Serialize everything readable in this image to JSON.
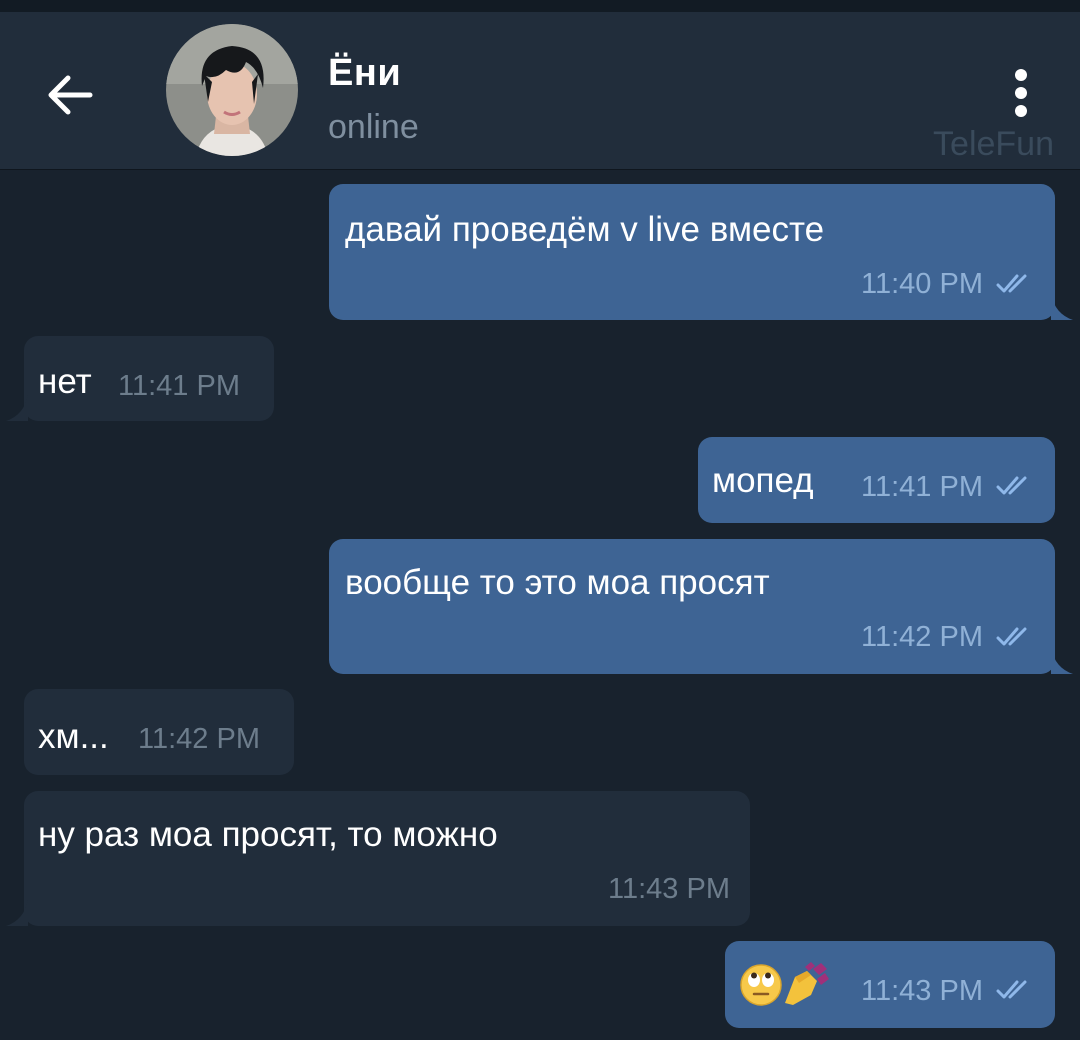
{
  "header": {
    "title": "Ёни",
    "status": "online",
    "watermark": "TeleFun",
    "back_icon": "arrow-left-icon",
    "menu_icon": "more-vertical-icon"
  },
  "colors": {
    "background": "#18222d",
    "header": "#212d3b",
    "outgoing_bubble": "#3e6494",
    "incoming_bubble": "#212d3b",
    "read_ticks": "#8fb8ea"
  },
  "messages": [
    {
      "direction": "out",
      "text": "давай проведём v live вместе",
      "time": "11:40 PM",
      "read": true
    },
    {
      "direction": "in",
      "text": "нет",
      "time": "11:41 PM"
    },
    {
      "direction": "out",
      "text": "мопед",
      "time": "11:41 PM",
      "read": true
    },
    {
      "direction": "out",
      "text": "вообще то это моа просят",
      "time": "11:42 PM",
      "read": true
    },
    {
      "direction": "in",
      "text": "хм...",
      "time": "11:42 PM"
    },
    {
      "direction": "in",
      "text": "ну раз моа просят, то можно",
      "time": "11:43 PM"
    },
    {
      "direction": "out",
      "text": "",
      "time": "11:43 PM",
      "read": true,
      "emoji_icons": [
        "face-with-rolling-eyes-icon",
        "nail-polish-icon"
      ]
    }
  ]
}
